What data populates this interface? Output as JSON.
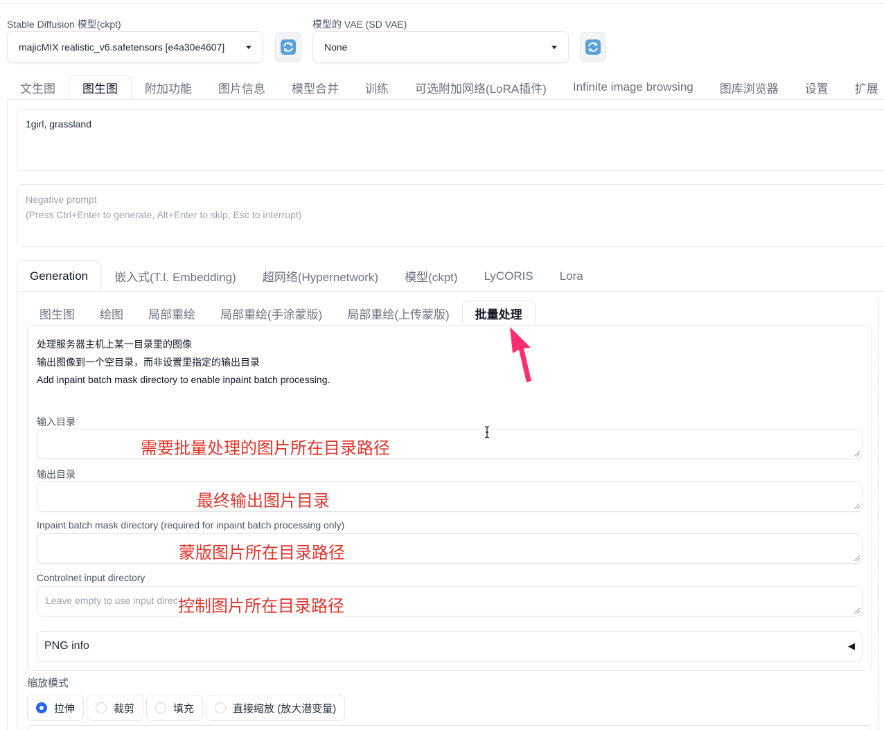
{
  "model": {
    "sd_label": "Stable Diffusion 模型(ckpt)",
    "sd_value": "majicMIX realistic_v6.safetensors [e4a30e4607]",
    "vae_label": "模型的 VAE (SD VAE)",
    "vae_value": "None"
  },
  "main_tabs": [
    "文生图",
    "图生图",
    "附加功能",
    "图片信息",
    "模型合并",
    "训练",
    "可选附加网络(LoRA插件)",
    "Infinite image browsing",
    "图库浏览器",
    "设置",
    "扩展"
  ],
  "prompt": {
    "positive": "1girl, grassland",
    "negative_placeholder_1": "Negative prompt",
    "negative_placeholder_2": "(Press Ctrl+Enter to generate, Alt+Enter to skip, Esc to interrupt)"
  },
  "extra_tabs": [
    "Generation",
    "嵌入式(T.I. Embedding)",
    "超网络(Hypernetwork)",
    "模型(ckpt)",
    "LyCORIS",
    "Lora"
  ],
  "img2img_tabs": [
    "图生图",
    "绘图",
    "局部重绘",
    "局部重绘(手涂蒙版)",
    "局部重绘(上传蒙版)",
    "批量处理"
  ],
  "batch": {
    "desc_1": "处理服务器主机上某一目录里的图像",
    "desc_2": "输出图像到一个空目录，而非设置里指定的输出目录",
    "desc_3": "Add inpaint batch mask directory to enable inpaint batch processing.",
    "input_dir_label": "输入目录",
    "input_dir_annot": "需要批量处理的图片所在目录路径",
    "output_dir_label": "输出目录",
    "output_dir_annot": "最终输出图片目录",
    "mask_dir_label": "Inpaint batch mask directory (required for inpaint batch processing only)",
    "mask_dir_annot": "蒙版图片所在目录路径",
    "controlnet_label": "Controlnet input directory",
    "controlnet_placeholder": "Leave empty to use input directory",
    "controlnet_annot": "控制图片所在目录路径",
    "png_info": "PNG info"
  },
  "resize": {
    "label": "缩放模式",
    "options": [
      "拉伸",
      "裁剪",
      "填充",
      "直接缩放 (放大潜变量)"
    ],
    "selected": 0
  },
  "colors": {
    "accent": "#2563eb",
    "annotation": "#e0342b",
    "arrow": "#ff2d6f"
  }
}
